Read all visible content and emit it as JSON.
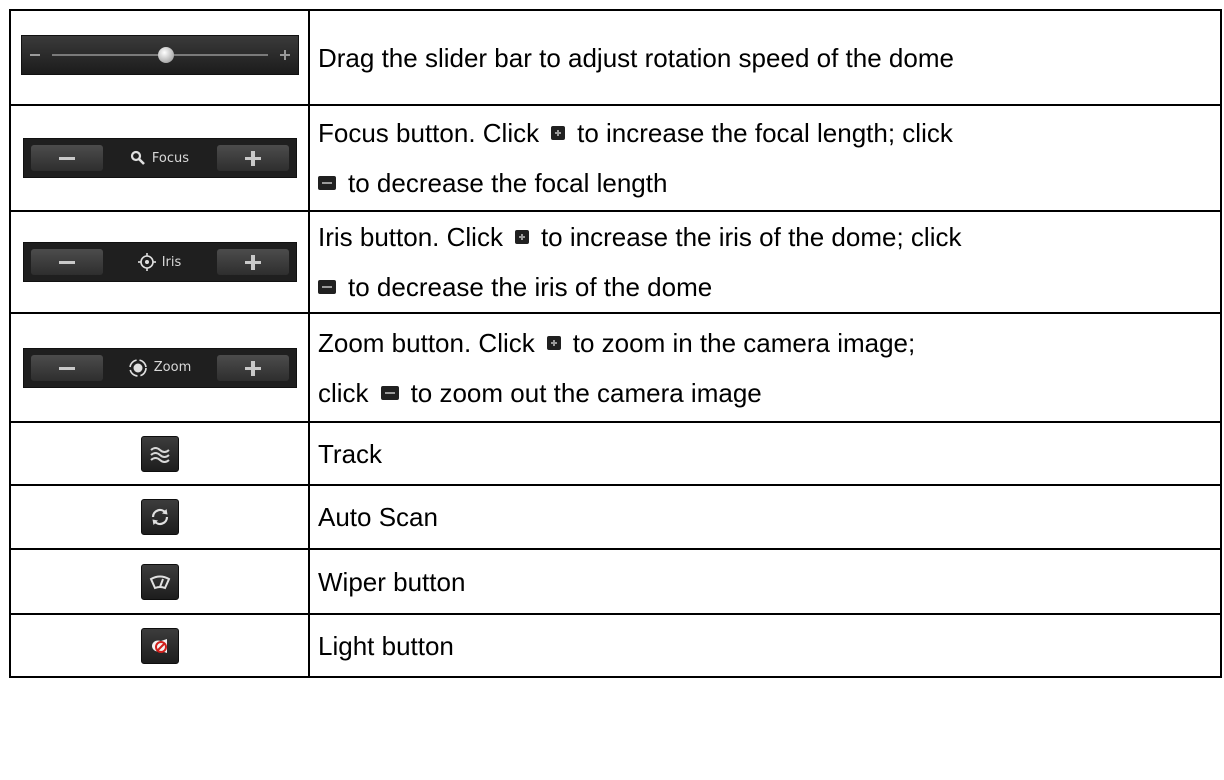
{
  "rows": [
    {
      "control": "speed-slider",
      "desc": [
        "Drag the slider bar to adjust rotation speed of the dome"
      ]
    },
    {
      "control": "focus-bar",
      "label": "Focus",
      "desc": [
        "Focus button. Click",
        "to increase the focal length; click",
        "to decrease the focal length"
      ]
    },
    {
      "control": "iris-bar",
      "label": "Iris",
      "desc": [
        "Iris button. Click",
        "to increase the iris of the dome; click",
        "to decrease the iris of the dome"
      ]
    },
    {
      "control": "zoom-bar",
      "label": "Zoom",
      "desc": [
        "Zoom button. Click",
        "to zoom in the camera image;",
        "click",
        "to zoom out the camera image"
      ]
    },
    {
      "control": "track-icon",
      "desc": [
        "Track"
      ]
    },
    {
      "control": "auto-scan-icon",
      "desc": [
        "Auto Scan"
      ]
    },
    {
      "control": "wiper-icon",
      "desc": [
        "Wiper button"
      ]
    },
    {
      "control": "light-icon",
      "desc": [
        "Light button"
      ]
    }
  ]
}
